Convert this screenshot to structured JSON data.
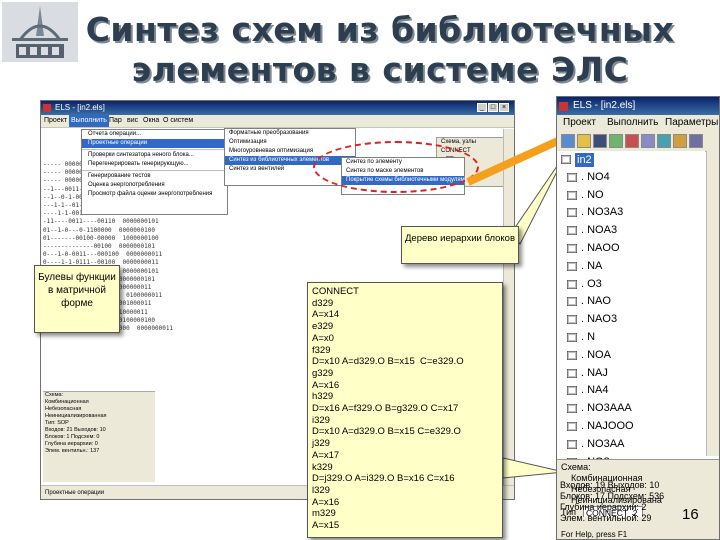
{
  "slide": {
    "title_line1": "Синтез схем из библиотечных",
    "title_line2": "элементов в системе ЭЛС",
    "page_number": "16"
  },
  "left_window": {
    "title": "ELS - [in2.els]",
    "menu": [
      "Проект",
      "Выполнить",
      "Пар",
      "вис",
      "Окна",
      "О систем"
    ],
    "run_menu": [
      "Отчета операции...",
      "Проектные операции",
      "Проверки синтезатора неного блока...",
      "Перегенерировать генерирующую...",
      "Генерирование тестов",
      "Оценка энергопотребления",
      "Просмотр файла оценки энергопотребления"
    ],
    "submenu": [
      "Форматные преобразования",
      "Оптимизация",
      "Многоуровневая оптимизация",
      "Синтез из библиотечных элементов",
      "Синтез из вентилей"
    ],
    "submenu2": [
      "Синтез по элементу",
      "Синтез по маске элементов",
      "Покрытие схемы библиотечными модулями"
    ],
    "dialog": [
      "Схема, узлы",
      "CONNECT",
      "в TTL"
    ],
    "matrix_rows": [
      "----- 00000011",
      "----- 00000011",
      "----- 00000100",
      "--1---0011-----00010  0000000111",
      "--1--0-1-0011--- 00010  0000000111",
      "---1-1--01-0-00011  0000000111",
      "----1-1-0011---00110  0010000011",
      "-11----0011----00110  0000000101",
      "01--1-0---0-1100000  0000000100",
      "01-------00100-00000  1000000100",
      "--------------00100  0000000101",
      "0---1-0-0011---000100  0000000011",
      "0----1-1-0111--00100  0000000011",
      "--1----0011----01100  0000000101",
      "1-------0-0-0-01100  0000000101",
      "--1------0-0-01100  0000000011",
      "0---1-1--0011---01100  0100000011",
      "----1-0-0-0-001100  0001000011",
      "------11----01100  0010000011",
      "01-1-0-0--011000000  0100000100",
      "1---------0011-----00000  0000000011"
    ],
    "panel": [
      "Схема:",
      "Комбинационная",
      "Небезопасная",
      "Неинициализированная",
      "Тип: SOP",
      "Входов: 21   Выходов: 10",
      "Блоков: 1   Подсхем: 0",
      "Глубина иерархии: 0",
      "Элем. вентильн.: 137"
    ],
    "status": "Проектные операции"
  },
  "callouts": {
    "bool_funcs": "Булевы функции в матричной форме",
    "tree_label": "Дерево иерархии блоков",
    "code_lines": [
      "CONNECT",
      "d329",
      "A=x14",
      "e329",
      "A=x0",
      "f329",
      "D=x10 A=d329.O B=x15  C=e329.O",
      "g329",
      "A=x16",
      "h329",
      "D=x16 A=f329.O B=g329.O C=x17",
      "i329",
      "D=x10 A=d329.O B=x15 C=e329.O",
      "j329",
      "A=x17",
      "k329",
      "D=j329.O A=i329.O B=x16 C=x16",
      "l329",
      "A=x16",
      "m329",
      "A=x15"
    ]
  },
  "right_window": {
    "title": "ELS - [in2.els]",
    "menu": [
      "Проект",
      "Выполнить",
      "Параметры"
    ],
    "tree_root": "in2",
    "tree_items": [
      ". NO4",
      ". NO",
      ". NO3A3",
      ". NOA3",
      ". NAOO",
      ". NA",
      ". O3",
      ". NAO",
      ". NAO3",
      ". N",
      ". NOA",
      ". NAJ",
      ". NA4",
      ". NO3AAA",
      ". NAJOOO",
      ". NO3AA",
      ". NO3"
    ],
    "panel": {
      "schema_label": "Схема:",
      "comb": "Комбинационная",
      "unsafe": "Небезопасная",
      "uninit": "Неинициализирована",
      "type_label": "Тип",
      "type_value": "CONNECT_2",
      "inputs": "Входов: 19    Выходов: 10",
      "blocks": "Блоков: 17   Подсхем: 536",
      "depth": "Глубина иерархии: 2",
      "elements": "Элем. вентильной: 29"
    },
    "status": "For Help, press F1"
  },
  "colors": {
    "title_text": "#2c3e4f",
    "callout_bg": "#ffffc8",
    "arrow": "#f4a01c",
    "dashed_ring": "#e02020",
    "selection": "#316ac5"
  }
}
